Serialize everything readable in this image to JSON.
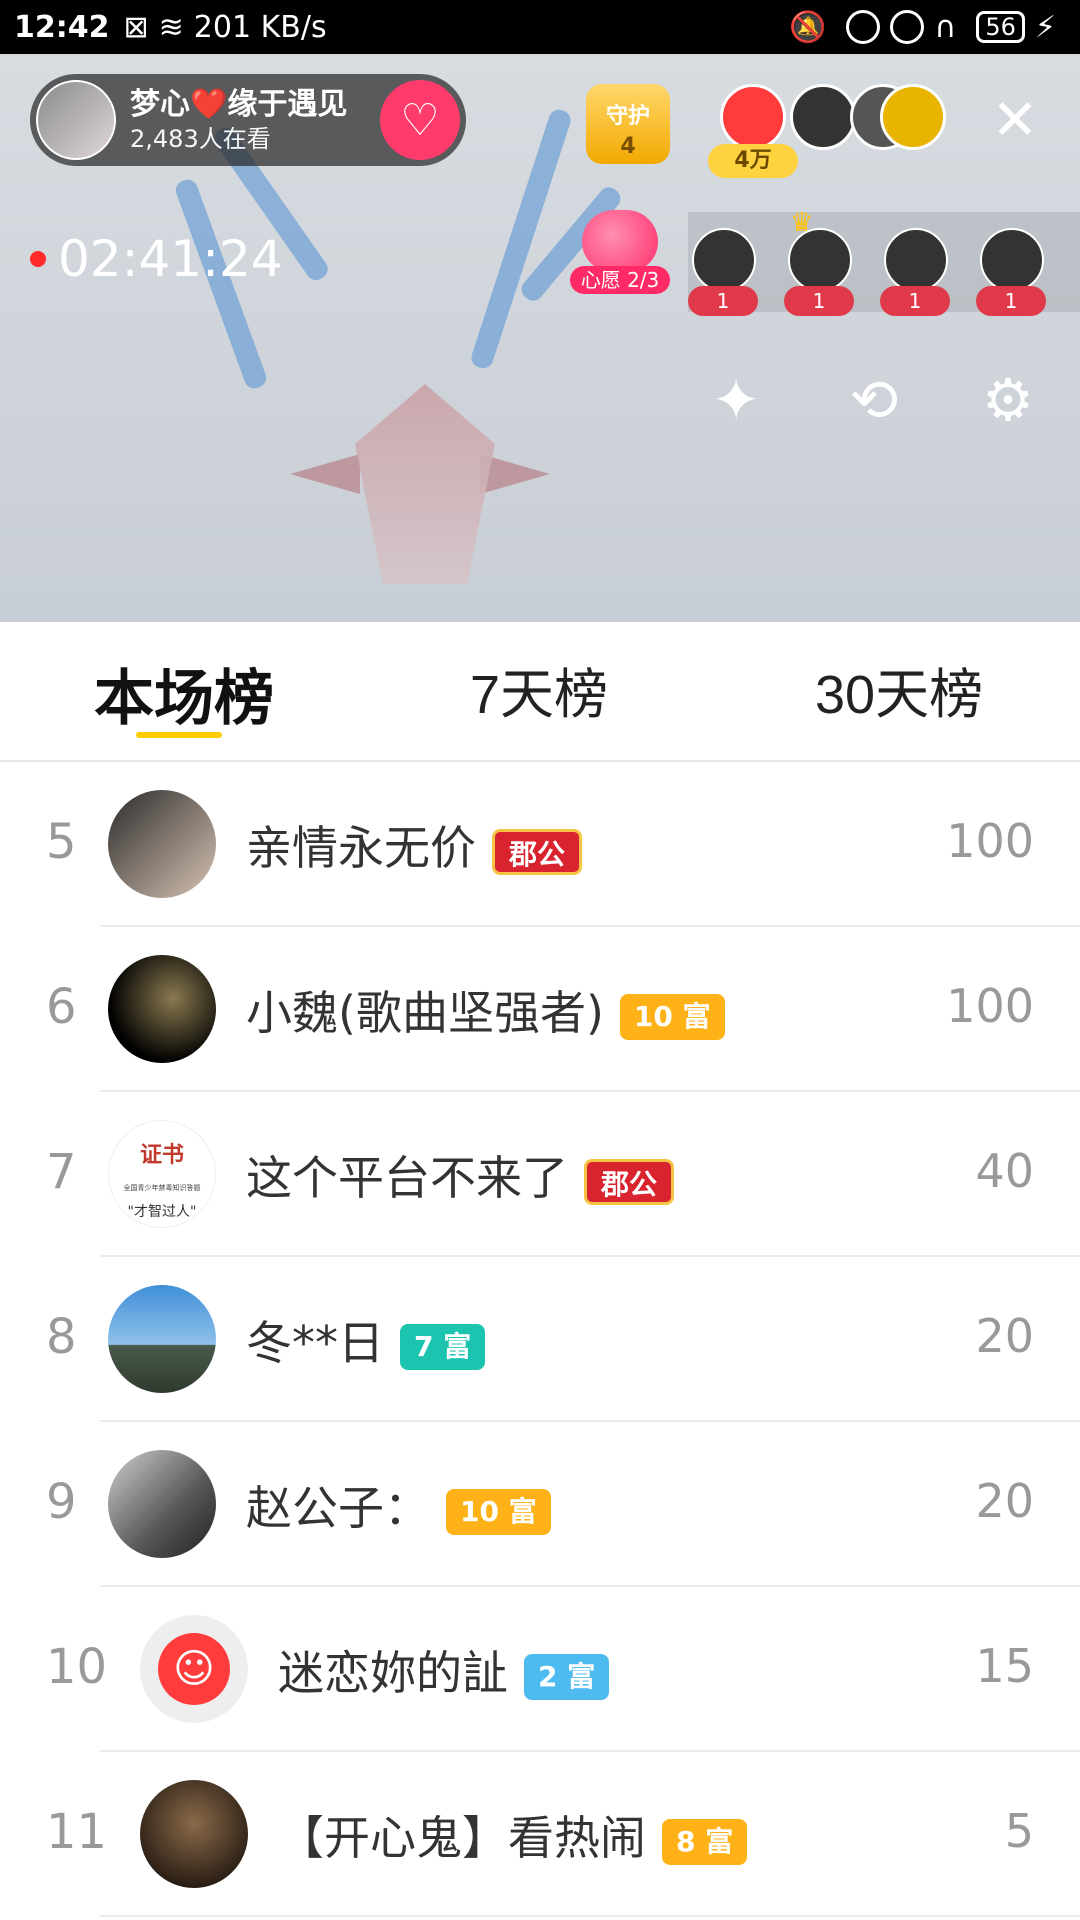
{
  "status_bar": {
    "time": "12:42",
    "speed": "201 KB/s",
    "battery": "56"
  },
  "host": {
    "name": "梦心❤️缘于遇见",
    "viewers": "2,483人在看"
  },
  "guard": {
    "label": "守护",
    "count": "4"
  },
  "top_fans": {
    "label": "4万"
  },
  "timer": "02:41:24",
  "wish": {
    "label": "心愿 2/3"
  },
  "gift_counts": [
    "1",
    "1",
    "1",
    "1"
  ],
  "tabs": [
    {
      "label": "本场榜",
      "active": true
    },
    {
      "label": "7天榜",
      "active": false
    },
    {
      "label": "30天榜",
      "active": false
    }
  ],
  "rows": [
    {
      "rank": "5",
      "name": "亲情永无价",
      "badge": "郡公",
      "badge_style": "red",
      "score": "100"
    },
    {
      "rank": "6",
      "name": "小魏(歌曲坚强者)",
      "badge": "10 富",
      "badge_style": "gold",
      "score": "100"
    },
    {
      "rank": "7",
      "name": "这个平台不来了",
      "badge": "郡公",
      "badge_style": "red",
      "score": "40"
    },
    {
      "rank": "8",
      "name": "冬**日",
      "badge": "7 富",
      "badge_style": "teal",
      "score": "20"
    },
    {
      "rank": "9",
      "name": "赵公子：",
      "badge": "10 富",
      "badge_style": "gold",
      "score": "20"
    },
    {
      "rank": "10",
      "name": "迷恋妳的訨",
      "badge": "2 富",
      "badge_style": "blue",
      "score": "15"
    },
    {
      "rank": "11",
      "name": "【开心鬼】看热闹",
      "badge": "8 富",
      "badge_style": "gold",
      "score": "5"
    }
  ],
  "avatar_seven": {
    "title": "证书",
    "line1": "全国青少年禁毒知识答题",
    "line2": "\"才智过人\""
  }
}
